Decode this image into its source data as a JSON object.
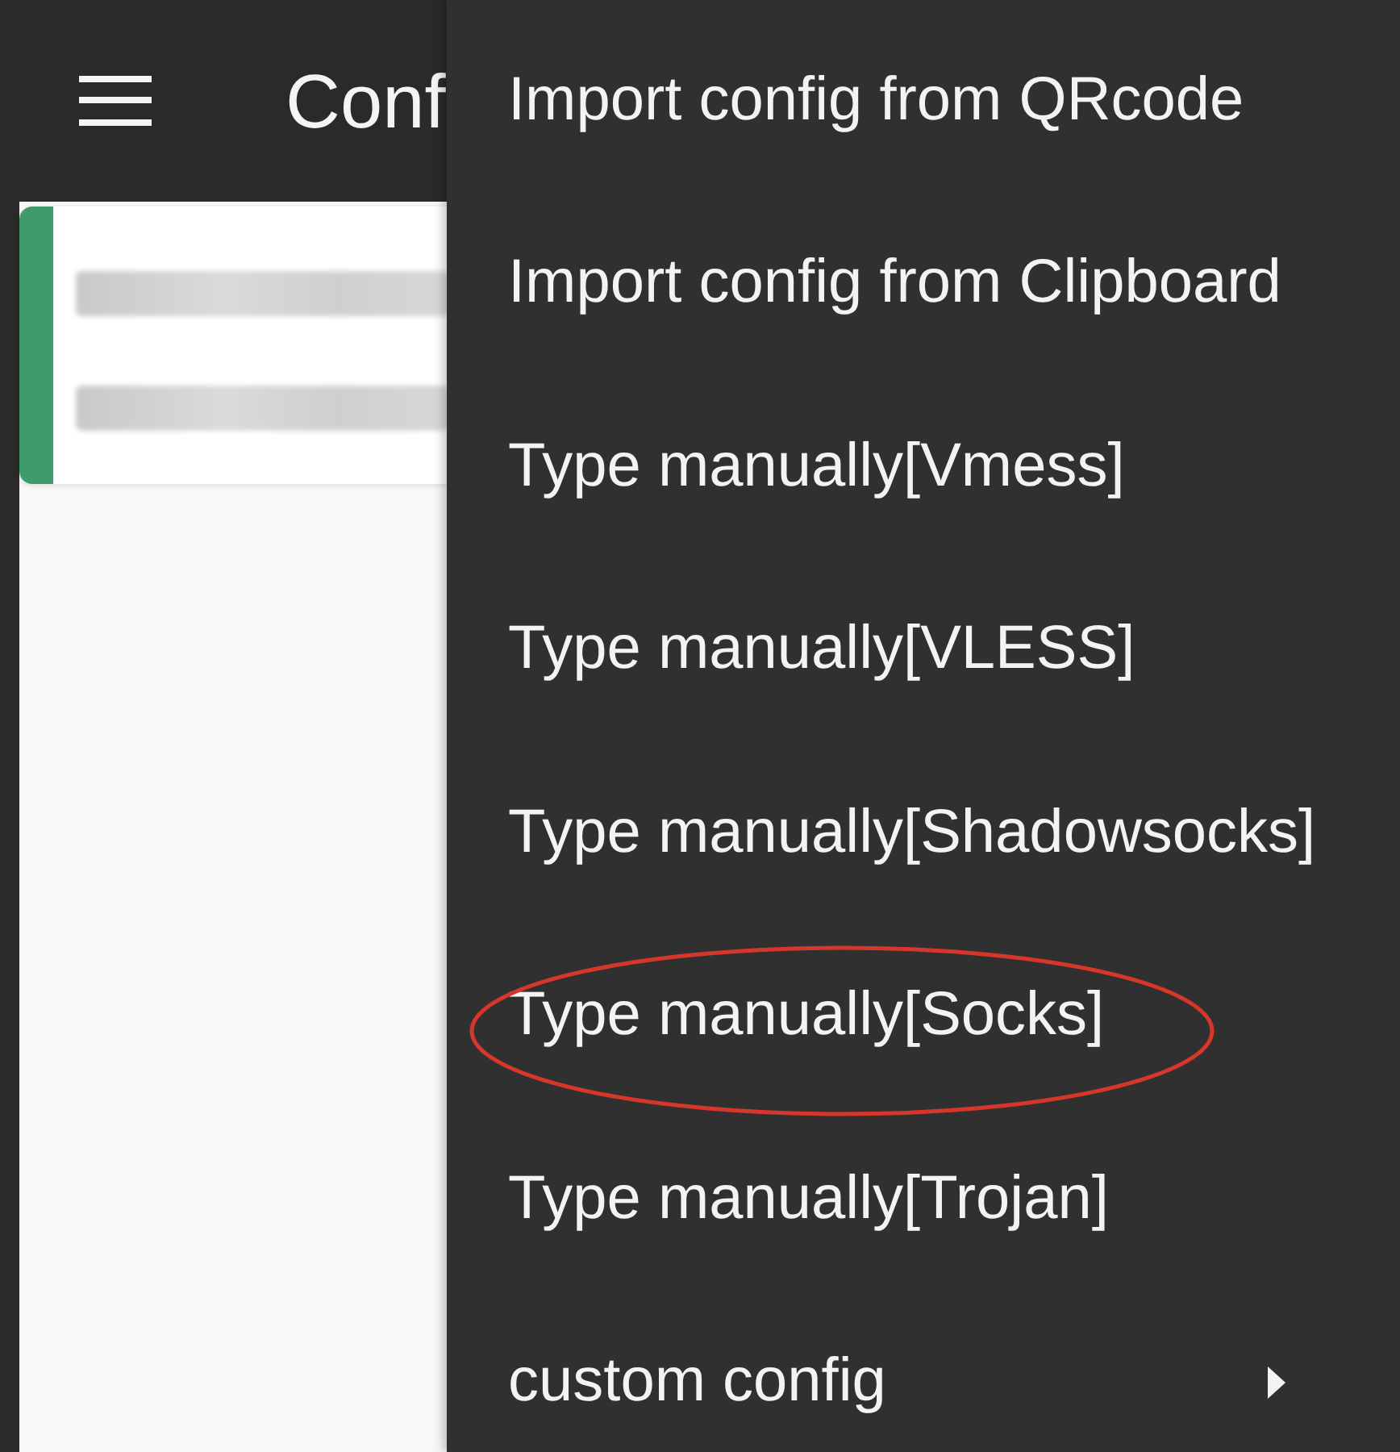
{
  "app_bar": {
    "title": "Conf"
  },
  "servers": [
    {
      "selected": true
    }
  ],
  "menu": {
    "items": [
      {
        "label": "Import config from QRcode",
        "has_submenu": false,
        "highlighted": false
      },
      {
        "label": "Import config from Clipboard",
        "has_submenu": false,
        "highlighted": false
      },
      {
        "label": "Type manually[Vmess]",
        "has_submenu": false,
        "highlighted": false
      },
      {
        "label": "Type manually[VLESS]",
        "has_submenu": false,
        "highlighted": false
      },
      {
        "label": "Type manually[Shadowsocks]",
        "has_submenu": false,
        "highlighted": false
      },
      {
        "label": "Type manually[Socks]",
        "has_submenu": false,
        "highlighted": true
      },
      {
        "label": "Type manually[Trojan]",
        "has_submenu": false,
        "highlighted": false
      },
      {
        "label": "custom config",
        "has_submenu": true,
        "highlighted": false
      }
    ]
  }
}
